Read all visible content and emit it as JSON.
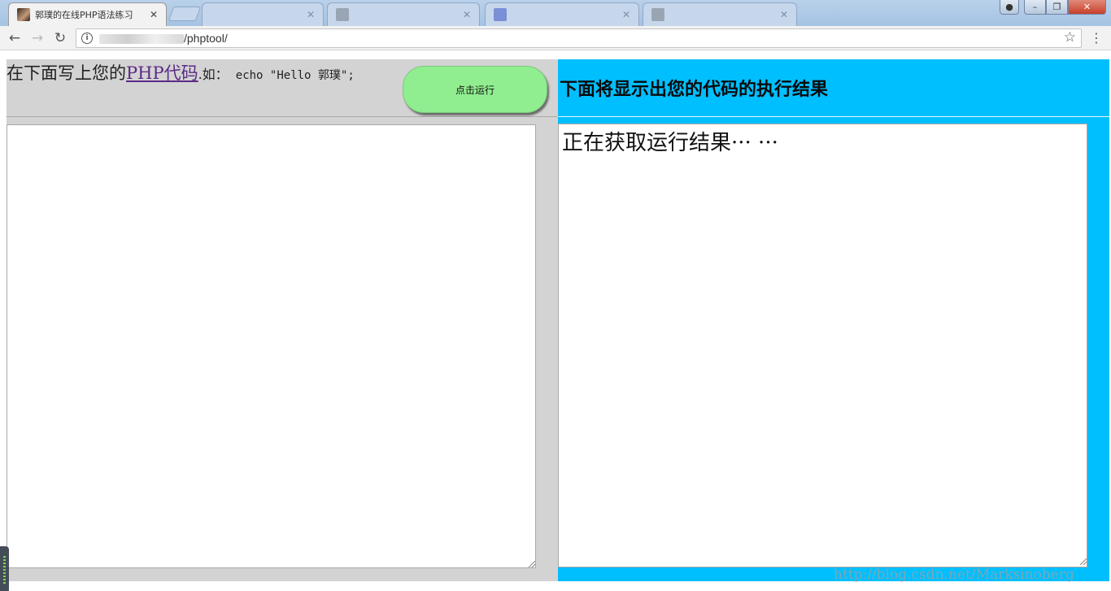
{
  "browser": {
    "tabs": [
      {
        "title": "郭璞的在线PHP语法练习",
        "active": true
      },
      {
        "title": "",
        "active": false
      },
      {
        "title": "",
        "active": false
      },
      {
        "title": "",
        "active": false
      },
      {
        "title": "",
        "active": false
      }
    ],
    "url_path": "/phptool/"
  },
  "left": {
    "intro_text": "在下面写上您的",
    "link_text": "PHP代码",
    "intro_sep": ".如：",
    "example": "echo \"Hello 郭璞\";",
    "run_button_label": "点击运行",
    "code_value": ""
  },
  "right": {
    "title": "下面将显示出您的代码的执行结果",
    "result_text": "正在获取运行结果··· ···"
  },
  "watermark": "http://blog.csdn.net/Marksinoberg",
  "colors": {
    "left_bg": "#d3d3d3",
    "right_bg": "#00bfff",
    "run_button": "#90ee90",
    "link": "#5b2a86"
  }
}
